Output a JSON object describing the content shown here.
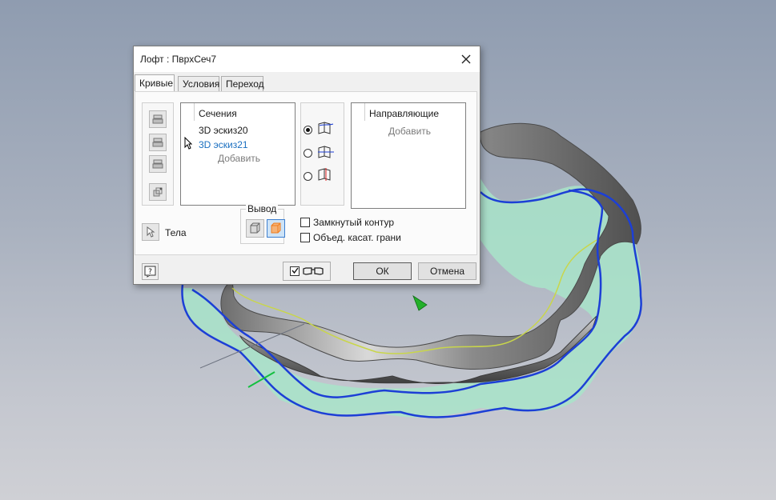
{
  "dialog": {
    "title": "Лофт : ПврхСеч7",
    "tabs": [
      {
        "label": "Кривые",
        "active": true
      },
      {
        "label": "Условия",
        "active": false
      },
      {
        "label": "Переход",
        "active": false
      }
    ],
    "sections": {
      "header": "Сечения",
      "items": [
        {
          "label": "3D эскиз20",
          "color": "#1b1b1b"
        },
        {
          "label": "3D эскиз21",
          "color": "#1a6fc0"
        }
      ],
      "add_label": "Добавить"
    },
    "rails": {
      "header": "Направляющие",
      "add_label": "Добавить"
    },
    "bodies_label": "Тела",
    "output_label": "Вывод",
    "closed_loop_label": "Замкнутый контур",
    "merge_faces_label": "Объед. касат. грани",
    "ok_label": "ОК",
    "cancel_label": "Отмена"
  },
  "colors": {
    "surface_fill": "#a8e4c9",
    "edge_blue": "#1c3fd6",
    "accent_orange": "#f07c1e"
  }
}
